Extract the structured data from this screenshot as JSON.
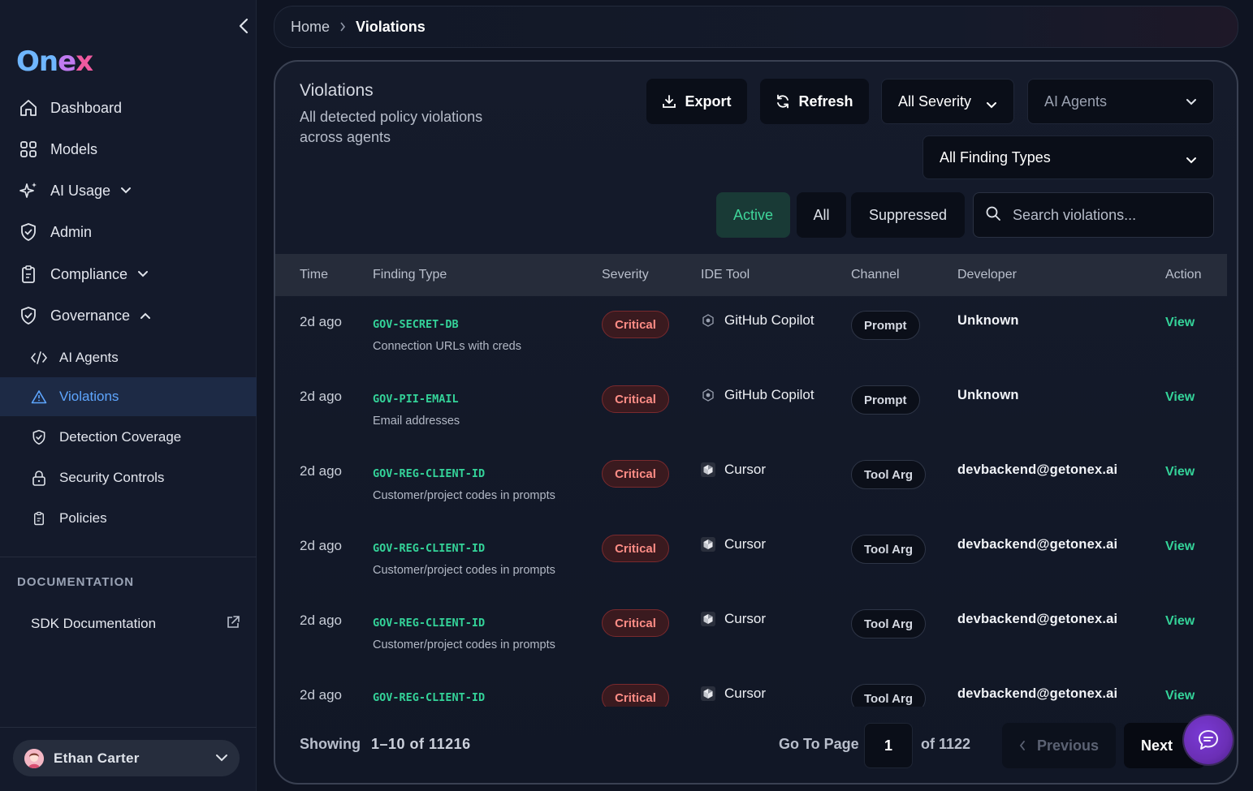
{
  "logo": {
    "part1": "On",
    "part2": "e",
    "part3": "x"
  },
  "sidebar": {
    "items": [
      {
        "label": "Dashboard",
        "icon": "home-icon"
      },
      {
        "label": "Models",
        "icon": "grid-icon"
      },
      {
        "label": "AI Usage",
        "icon": "sparkles-icon"
      },
      {
        "label": "Admin",
        "icon": "shield-check-icon"
      },
      {
        "label": "Compliance",
        "icon": "clipboard-icon"
      },
      {
        "label": "Governance",
        "icon": "shield-check-icon"
      }
    ],
    "governance_items": [
      {
        "label": "AI Agents",
        "icon": "code-icon"
      },
      {
        "label": "Violations",
        "icon": "warning-icon"
      },
      {
        "label": "Detection Coverage",
        "icon": "shield-icon"
      },
      {
        "label": "Security Controls",
        "icon": "lock-icon"
      },
      {
        "label": "Policies",
        "icon": "clipboard-icon"
      }
    ],
    "doc_heading": "DOCUMENTATION",
    "sdk_link": "SDK Documentation",
    "user_name": "Ethan Carter"
  },
  "breadcrumb": {
    "home": "Home",
    "current": "Violations"
  },
  "card": {
    "title": "Violations",
    "subtitle": "All detected policy violations across agents",
    "export_label": "Export",
    "refresh_label": "Refresh",
    "severity_select": "All Severity",
    "agents_select": "AI Agents",
    "finding_select": "All Finding Types",
    "tabs": {
      "active": "Active",
      "all": "All",
      "suppressed": "Suppressed"
    },
    "search_placeholder": "Search violations..."
  },
  "table": {
    "headers": [
      "Time",
      "Finding Type",
      "Severity",
      "IDE Tool",
      "Channel",
      "Developer",
      "Action"
    ],
    "rows": [
      {
        "time": "2d ago",
        "code": "GOV-SECRET-DB",
        "desc": "Connection URLs with creds",
        "severity": "Critical",
        "ide": "GitHub Copilot",
        "ide_icon": "copilot-icon",
        "channel": "Prompt",
        "developer": "Unknown",
        "action": "View"
      },
      {
        "time": "2d ago",
        "code": "GOV-PII-EMAIL",
        "desc": "Email addresses",
        "severity": "Critical",
        "ide": "GitHub Copilot",
        "ide_icon": "copilot-icon",
        "channel": "Prompt",
        "developer": "Unknown",
        "action": "View"
      },
      {
        "time": "2d ago",
        "code": "GOV-REG-CLIENT-ID",
        "desc": "Customer/project codes in prompts",
        "severity": "Critical",
        "ide": "Cursor",
        "ide_icon": "cursor-icon",
        "channel": "Tool Arg",
        "developer": "devbackend@getonex.ai",
        "action": "View"
      },
      {
        "time": "2d ago",
        "code": "GOV-REG-CLIENT-ID",
        "desc": "Customer/project codes in prompts",
        "severity": "Critical",
        "ide": "Cursor",
        "ide_icon": "cursor-icon",
        "channel": "Tool Arg",
        "developer": "devbackend@getonex.ai",
        "action": "View"
      },
      {
        "time": "2d ago",
        "code": "GOV-REG-CLIENT-ID",
        "desc": "Customer/project codes in prompts",
        "severity": "Critical",
        "ide": "Cursor",
        "ide_icon": "cursor-icon",
        "channel": "Tool Arg",
        "developer": "devbackend@getonex.ai",
        "action": "View"
      },
      {
        "time": "2d ago",
        "code": "GOV-REG-CLIENT-ID",
        "desc": "",
        "severity": "Critical",
        "ide": "Cursor",
        "ide_icon": "cursor-icon",
        "channel": "Tool Arg",
        "developer": "devbackend@getonex.ai",
        "action": "View"
      }
    ]
  },
  "pagination": {
    "showing_label": "Showing",
    "range": "1–10 of 11216",
    "goto_label": "Go To Page",
    "page": "1",
    "of_pages": "of 1122",
    "prev_label": "Previous",
    "next_label": "Next"
  },
  "colors": {
    "accent_green": "#34d399",
    "critical_red": "#ff8d86",
    "active_blue": "#5ea6ff"
  }
}
